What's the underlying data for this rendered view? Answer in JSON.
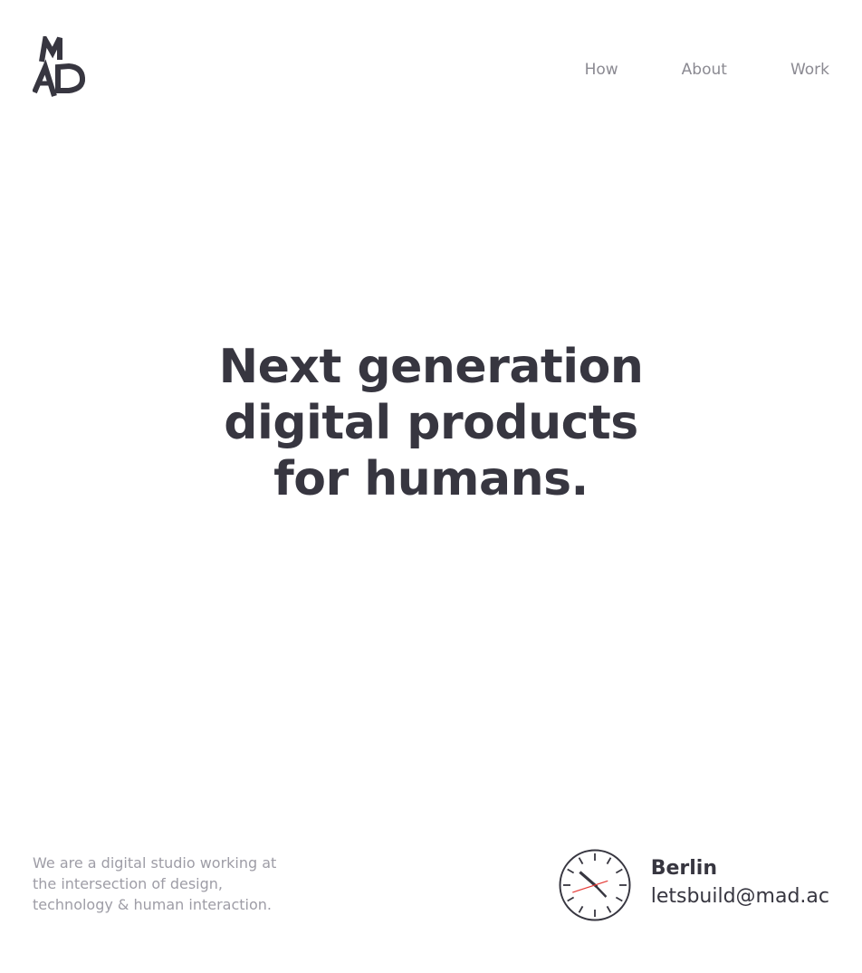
{
  "brand": {
    "logo_text": "MAD",
    "color": "#373640"
  },
  "nav": {
    "items": [
      {
        "label": "How"
      },
      {
        "label": "About"
      },
      {
        "label": "Work"
      }
    ]
  },
  "hero": {
    "lines": [
      "Next generation",
      "digital products",
      "for humans."
    ]
  },
  "intro": {
    "lines": [
      "We are a digital studio working at",
      "the intersection of design,",
      "technology & human interaction."
    ]
  },
  "contact": {
    "city": "Berlin",
    "email": "letsbuild@mad.ac"
  },
  "clock": {
    "time": "10:22",
    "hour": 10,
    "minute": 22,
    "second": 42,
    "second_hand_color": "#e53935"
  },
  "colors": {
    "text_dark": "#373640",
    "text_muted": "#8b8a92",
    "background": "#ffffff"
  }
}
